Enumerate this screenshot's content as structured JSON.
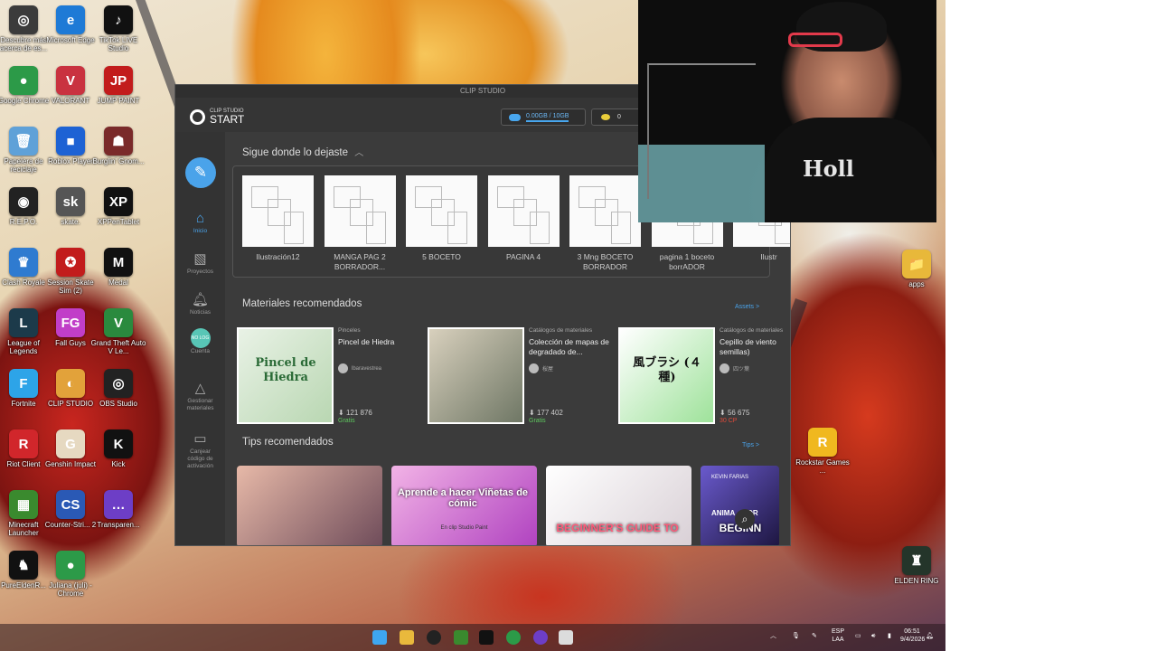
{
  "desktop": {
    "icons": [
      {
        "label": "Descubre más acerca de es...",
        "glyph": "◎",
        "color": "#3b3b3b",
        "icon": "spotlight-icon"
      },
      {
        "label": "Microsoft Edge",
        "glyph": "e",
        "color": "#1e7ad6",
        "icon": "edge-icon"
      },
      {
        "label": "TikTok LIVE Studio",
        "glyph": "♪",
        "color": "#111",
        "icon": "tiktok-icon"
      },
      {
        "label": "Google Chrome",
        "glyph": "●",
        "color": "#2c9a48",
        "icon": "chrome-icon"
      },
      {
        "label": "VALORANT",
        "glyph": "V",
        "color": "#c93240",
        "icon": "valorant-icon"
      },
      {
        "label": "JUMP PAINT",
        "glyph": "JP",
        "color": "#c21c1c",
        "icon": "jump-paint-icon"
      },
      {
        "label": "Papelera de reciclaje",
        "glyph": "🗑",
        "color": "#5fa1d8",
        "icon": "recycle-bin-icon"
      },
      {
        "label": "Roblox Player",
        "glyph": "■",
        "color": "#1d62d4",
        "icon": "roblox-icon"
      },
      {
        "label": "Burglin' Gnom...",
        "glyph": "☗",
        "color": "#7a2a2a",
        "icon": "game-icon"
      },
      {
        "label": "R.E.P.O.",
        "glyph": "◉",
        "color": "#222",
        "icon": "repo-icon"
      },
      {
        "label": "skate.",
        "glyph": "sk",
        "color": "#555",
        "icon": "skate-icon"
      },
      {
        "label": "XPPenTablet",
        "glyph": "XP",
        "color": "#111",
        "icon": "xppen-icon"
      },
      {
        "label": "Clash Royale",
        "glyph": "♛",
        "color": "#2f7bd0",
        "icon": "clash-icon"
      },
      {
        "label": "Session Skate Sim (2)",
        "glyph": "✪",
        "color": "#c21c1c",
        "icon": "session-icon"
      },
      {
        "label": "Medal",
        "glyph": "M",
        "color": "#111",
        "icon": "medal-icon"
      },
      {
        "label": "League of Legends",
        "glyph": "L",
        "color": "#1c3a4a",
        "icon": "lol-icon"
      },
      {
        "label": "Fall Guys",
        "glyph": "FG",
        "color": "#c13ec8",
        "icon": "fallguys-icon"
      },
      {
        "label": "Grand Theft Auto V Le...",
        "glyph": "V",
        "color": "#2a8a3e",
        "icon": "gta-icon"
      },
      {
        "label": "Fortnite",
        "glyph": "F",
        "color": "#2da4e8",
        "icon": "fortnite-icon"
      },
      {
        "label": "CLIP STUDIO",
        "glyph": "◐",
        "color": "#e2a23a",
        "icon": "clip-studio-icon"
      },
      {
        "label": "OBS Studio",
        "glyph": "◎",
        "color": "#222",
        "icon": "obs-icon"
      },
      {
        "label": "Riot Client",
        "glyph": "R",
        "color": "#d1262b",
        "icon": "riot-icon"
      },
      {
        "label": "Genshin Impact",
        "glyph": "G",
        "color": "#e6d9c1",
        "icon": "genshin-icon"
      },
      {
        "label": "Kick",
        "glyph": "K",
        "color": "#111",
        "icon": "kick-icon"
      },
      {
        "label": "Minecraft Launcher",
        "glyph": "▦",
        "color": "#3a8a2e",
        "icon": "minecraft-icon"
      },
      {
        "label": "Counter-Stri... 2",
        "glyph": "CS",
        "color": "#2a59b5",
        "icon": "cs2-icon"
      },
      {
        "label": "Transparen...",
        "glyph": "…",
        "color": "#6d3ec6",
        "icon": "transparent-icon"
      },
      {
        "label": "PureEldenR...",
        "glyph": "♞",
        "color": "#111",
        "icon": "elden-mod-icon"
      },
      {
        "label": "Juliana (juli) - Chrome",
        "glyph": "●",
        "color": "#2c9a48",
        "icon": "chrome-profile-icon"
      }
    ],
    "right_icons": [
      {
        "label": "apps",
        "glyph": "📁",
        "color": "#e8b83a",
        "icon": "folder-icon"
      },
      {
        "label": "Rockstar Games ...",
        "glyph": "R",
        "color": "#f0b81f",
        "icon": "rockstar-icon"
      },
      {
        "label": "ELDEN RING",
        "glyph": "♜",
        "color": "#24352a",
        "icon": "elden-ring-icon"
      }
    ]
  },
  "clip": {
    "window_title": "CLIP STUDIO",
    "logo_small": "CLIP STUDIO",
    "logo_big": "START",
    "cloud": "0.00GB / 10GB",
    "coins": "0",
    "nav": {
      "draw": "Dibujar",
      "home": "Inicio",
      "projects": "Proyectos",
      "news": "Noticias",
      "account_badge": "NO LOG",
      "account": "Cuenta",
      "manage": "Gestionar materiales",
      "redeem": "Canjear código de activación"
    },
    "recent": {
      "title": "Sigue donde lo dejaste",
      "items": [
        {
          "caption": "Ilustración12"
        },
        {
          "caption": "MANGA PAG 2 BORRADOR..."
        },
        {
          "caption": "5 BOCETO"
        },
        {
          "caption": "PAGINA 4"
        },
        {
          "caption": "3 Mng BOCETO BORRADOR"
        },
        {
          "caption": "pagina 1 boceto borrADOR"
        },
        {
          "caption": "Ilustr"
        }
      ]
    },
    "materials": {
      "title": "Materiales recomendados",
      "more": "Assets >",
      "items": [
        {
          "category": "Pinceles",
          "name": "Pincel de Hiedra",
          "author": "lbaravestrea",
          "downloads": "121 876",
          "price": "Gratis",
          "price_color": "#5ec85e",
          "art": "Pincel de Hiedra"
        },
        {
          "category": "Catálogos de materiales",
          "name": "Colección de mapas de degradado de...",
          "author": "桜屋",
          "downloads": "177 402",
          "price": "Gratis",
          "price_color": "#5ec85e",
          "art": ""
        },
        {
          "category": "Catálogos de materiales",
          "name": "Cepillo de viento semillas)",
          "author": "四ツ葉",
          "downloads": "56 675",
          "price": "30 CP",
          "price_color": "#e04a3a",
          "art": "風ブラシ (４種)"
        }
      ]
    },
    "tips": {
      "title": "Tips recomendados",
      "more": "Tips >",
      "cards": [
        {
          "text": ""
        },
        {
          "text": "Aprende a hacer Viñetas de cómic",
          "sub": "En clip Studio Paint"
        },
        {
          "text": "BEGINNER'S GUIDE TO"
        },
        {
          "text": "BEGINN",
          "badge": "KEVIN FARIAS",
          "top": "ANIMA    FOR"
        }
      ]
    }
  },
  "taskbar": {
    "lang": "ESP\nLAA",
    "time": "06:51",
    "date": "9/4/2026"
  }
}
